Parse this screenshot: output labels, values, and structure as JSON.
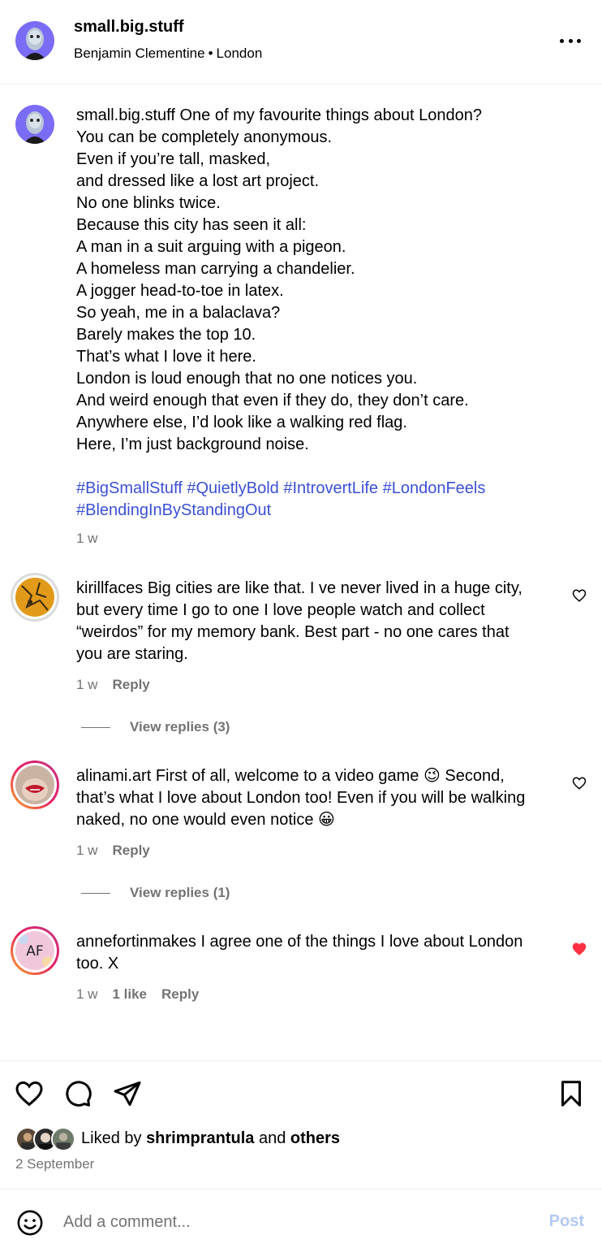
{
  "header": {
    "username": "small.big.stuff",
    "artist": "Benjamin Clementine",
    "separator": "•",
    "location": "London"
  },
  "caption": {
    "username": "small.big.stuff",
    "text": "One of my favourite things about London?\nYou can be completely anonymous.\nEven if you’re tall, masked,\nand dressed like a lost art project.\nNo one blinks twice.\nBecause this city has seen it all:\nA man in a suit arguing with a pigeon.\nA homeless man carrying a chandelier.\nA jogger head-to-toe in latex.\nSo yeah, me in a balaclava?\nBarely makes the top 10.\nThat’s what I love it here.\nLondon is loud enough that no one notices you.\nAnd weird enough that even if they do, they don’t care.\nAnywhere else, I’d look like a walking red flag.\nHere, I’m just background noise.",
    "hashtags": "#BigSmallStuff #QuietlyBold #IntrovertLife #LondonFeels\n#BlendingInByStandingOut",
    "time": "1 w"
  },
  "comments": [
    {
      "username": "kirillfaces",
      "text": "Big cities are like that. I ve never lived in a huge city, but every time I go to one I love people watch and collect “weirdos” for my memory bank. Best part - no one cares that you are staring.",
      "time": "1 w",
      "reply_label": "Reply",
      "view_replies": "View replies (3)",
      "liked": false
    },
    {
      "username": "alinami.art",
      "text": "First of all, welcome to a video game 😉 Second, that’s what I love about London too! Even if you will be walking naked, no one would even notice 😀",
      "time": "1 w",
      "reply_label": "Reply",
      "view_replies": "View replies (1)",
      "liked": false
    },
    {
      "username": "annefortinmakes",
      "text": "I agree one of the things I love about London too. X",
      "time": "1 w",
      "likes": "1 like",
      "reply_label": "Reply",
      "liked": true
    }
  ],
  "actions": {
    "icons": [
      "heart-icon",
      "comment-icon",
      "share-icon",
      "bookmark-icon"
    ],
    "liked_by_prefix": "Liked by",
    "liked_by_user": "shrimprantula",
    "liked_by_and": "and",
    "liked_by_others": "others",
    "date": "2 September"
  },
  "composer": {
    "placeholder": "Add a comment...",
    "post_label": "Post"
  },
  "colors": {
    "link": "#3b50d6",
    "muted": "#737373",
    "like_red": "#ff3040",
    "post_disabled": "#b2c8f5",
    "avatar_bg": "#7b6cf6"
  }
}
